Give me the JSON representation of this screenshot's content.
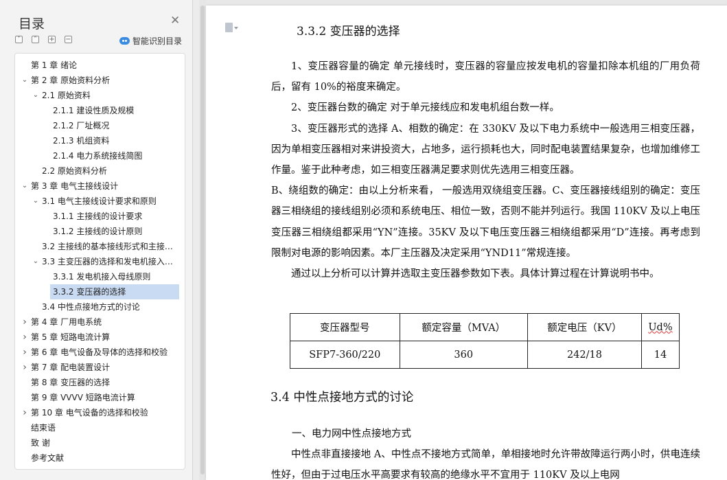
{
  "toc": {
    "title": "目录",
    "smart_label": "智能识别目录",
    "items": [
      {
        "label": "第 1 章  绪论",
        "level": 0,
        "arrow": ""
      },
      {
        "label": "第 2 章  原始资料分析",
        "level": 0,
        "arrow": "down"
      },
      {
        "label": "2.1  原始资料",
        "level": 1,
        "arrow": "down"
      },
      {
        "label": "2.1.1  建设性质及规模",
        "level": 2,
        "arrow": ""
      },
      {
        "label": "2.1.2  厂址概况",
        "level": 2,
        "arrow": ""
      },
      {
        "label": "2.1.3  机组资料",
        "level": 2,
        "arrow": ""
      },
      {
        "label": "2.1.4  电力系统接线简图",
        "level": 2,
        "arrow": ""
      },
      {
        "label": "2.2  原始资料分析",
        "level": 1,
        "arrow": ""
      },
      {
        "label": "第 3 章  电气主接线设计",
        "level": 0,
        "arrow": "down"
      },
      {
        "label": "3.1  电气主接线设计要求和原则",
        "level": 1,
        "arrow": "down"
      },
      {
        "label": "3.1.1  主接线的设计要求",
        "level": 2,
        "arrow": ""
      },
      {
        "label": "3.1.2  主接线的设计原则",
        "level": 2,
        "arrow": ""
      },
      {
        "label": "3.2  主接线的基本接线形式和主接线的选择",
        "level": 1,
        "arrow": ""
      },
      {
        "label": "3.3  主变压器的选择和发电机接入方式",
        "level": 1,
        "arrow": "down"
      },
      {
        "label": "3.3.1  发电机接入母线原则",
        "level": 2,
        "arrow": ""
      },
      {
        "label": "3.3.2  变压器的选择",
        "level": 2,
        "arrow": "",
        "selected": true
      },
      {
        "label": "3.4  中性点接地方式的讨论",
        "level": 1,
        "arrow": ""
      },
      {
        "label": "第 4 章  厂用电系统",
        "level": 0,
        "arrow": "right"
      },
      {
        "label": "第 5 章  短路电流计算",
        "level": 0,
        "arrow": "right"
      },
      {
        "label": "第 6 章  电气设备及导体的选择和校验",
        "level": 0,
        "arrow": "right"
      },
      {
        "label": "第 7 章  配电装置设计",
        "level": 0,
        "arrow": "right"
      },
      {
        "label": "第 8 章  变压器的选择",
        "level": 0,
        "arrow": ""
      },
      {
        "label": "第 9 章  VVVV  短路电流计算",
        "level": 0,
        "arrow": ""
      },
      {
        "label": "第 10 章  电气设备的选择和校验",
        "level": 0,
        "arrow": "right"
      },
      {
        "label": "结束语",
        "level": 0,
        "arrow": ""
      },
      {
        "label": "致    谢",
        "level": 0,
        "arrow": ""
      },
      {
        "label": "参考文献",
        "level": 0,
        "arrow": ""
      }
    ]
  },
  "doc": {
    "heading_332": "3.3.2  变压器的选择",
    "p1": "1、变压器容量的确定   单元接线时，变压器的容量应按发电机的容量扣除本机组的厂用负荷后，留有 10%的裕度来确定。",
    "p2": "2、变压器台数的确定   对于单元接线应和发电机组台数一样。",
    "p3a": "3、变压器形式的选择   A、相数的确定：在 330KV 及以下电力系统中一般选用三相变压器，因为单相变压器相对来讲投资大，占地多，运行损耗也大，同时配电装置结果复杂，也增加维修工作量。鉴于此种考虑，如三相变压器满足要求则优先选用三相变压器。",
    "p3b": "B、绕组数的确定：由以上分析来看，  一般选用双绕组变压器。C、变压器接线组别的确定：变压器三相绕组的接线组别必须和系统电压、相位一致，否则不能并列运行。我国 110KV 及以上电压变压器三相绕组都采用“YN”连接。35KV 及以下电压变压器三相绕组都采用“D”连接。再考虑到限制对电源的影响因素。本厂主压器及决定采用“YND11”常规连接。",
    "p4": "通过以上分析可以计算并选取主变压器参数如下表。具体计算过程在计算说明书中。",
    "table": {
      "headers": [
        "变压器型号",
        "额定容量（MVA）",
        "额定电压（KV）",
        "Ud%"
      ],
      "row": [
        "SFP7-360/220",
        "360",
        "242/18",
        "14"
      ]
    },
    "heading_34": "3.4  中性点接地方式的讨论",
    "sub1": "一、电力网中性点接地方式",
    "p5": "中性点非直接接地   A、中性点不接地方式简单，单相接地时允许带故障运行两小时，供电连续性好，但由于过电压水平高要求有较高的绝缘水平不宜用于 110KV 及以上电网"
  }
}
